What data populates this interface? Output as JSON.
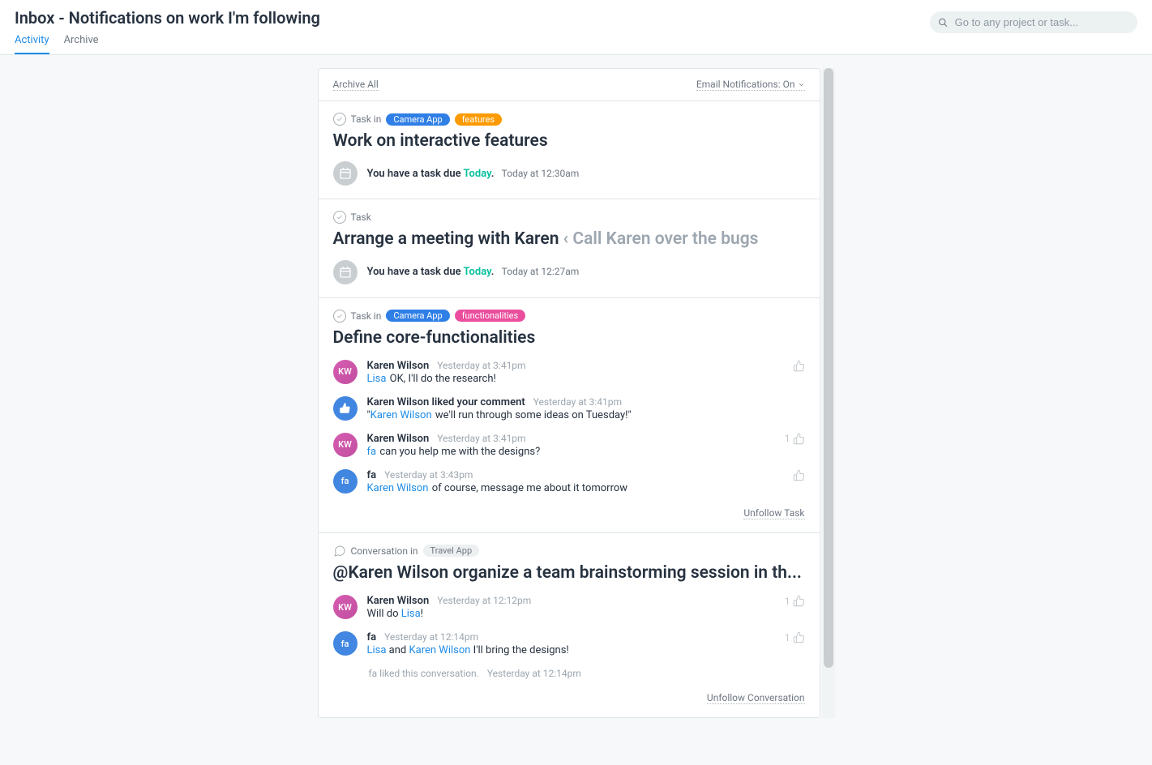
{
  "header": {
    "title": "Inbox - Notifications on work I'm following",
    "tabs": {
      "activity": "Activity",
      "archive": "Archive"
    },
    "search_placeholder": "Go to any project or task..."
  },
  "toolbar": {
    "archive_all": "Archive All",
    "email_notif_label": "Email Notifications: On"
  },
  "cards": {
    "c0": {
      "type_label": "Task in",
      "pills": {
        "p0": "Camera App",
        "p1": "features"
      },
      "title": "Work on interactive features",
      "due_prefix": "You have a task due ",
      "due_when": "Today",
      "due_period": ".",
      "due_time": "Today at 12:30am"
    },
    "c1": {
      "type_label": "Task",
      "title_main": "Arrange a meeting with Karen ",
      "title_faded": "‹ Call Karen over the bugs",
      "due_prefix": "You have a task due ",
      "due_when": "Today",
      "due_period": ".",
      "due_time": "Today at 12:27am"
    },
    "c2": {
      "type_label": "Task in",
      "pills": {
        "p0": "Camera App",
        "p1": "functionalities"
      },
      "title": "Define core-functionalities",
      "comments": {
        "cm0": {
          "author": "Karen Wilson",
          "ts": "Yesterday at 3:41pm",
          "mention": "Lisa",
          "text": " OK, I'll do the research!"
        },
        "cm1": {
          "author": "Karen Wilson liked your comment",
          "ts": "Yesterday at 3:41pm",
          "q1": "\"",
          "mention": "Karen Wilson",
          "text": " we'll run through some ideas on Tuesday!\""
        },
        "cm2": {
          "author": "Karen Wilson",
          "ts": "Yesterday at 3:41pm",
          "mention": "fa",
          "text": " can you help me with the designs?",
          "likes": "1"
        },
        "cm3": {
          "author": "fa",
          "ts": "Yesterday at 3:43pm",
          "mention": "Karen Wilson",
          "text": " of course, message me about it tomorrow"
        }
      },
      "unfollow": "Unfollow Task"
    },
    "c3": {
      "type_label": "Conversation in",
      "pill": "Travel App",
      "title": "@Karen Wilson organize a team brainstorming session in th...",
      "comments": {
        "cm0": {
          "author": "Karen Wilson",
          "ts": "Yesterday at 12:12pm",
          "pre": "Will do ",
          "mention": "Lisa",
          "post": "!",
          "likes": "1"
        },
        "cm1": {
          "author": "fa",
          "ts": "Yesterday at 12:14pm",
          "m1": "Lisa",
          "and": " and ",
          "m2": "Karen Wilson",
          "post": " I'll bring the designs!",
          "likes": "1"
        }
      },
      "sys": {
        "text": "fa liked this conversation.",
        "ts": "Yesterday at 12:14pm"
      },
      "unfollow": "Unfollow Conversation"
    }
  }
}
